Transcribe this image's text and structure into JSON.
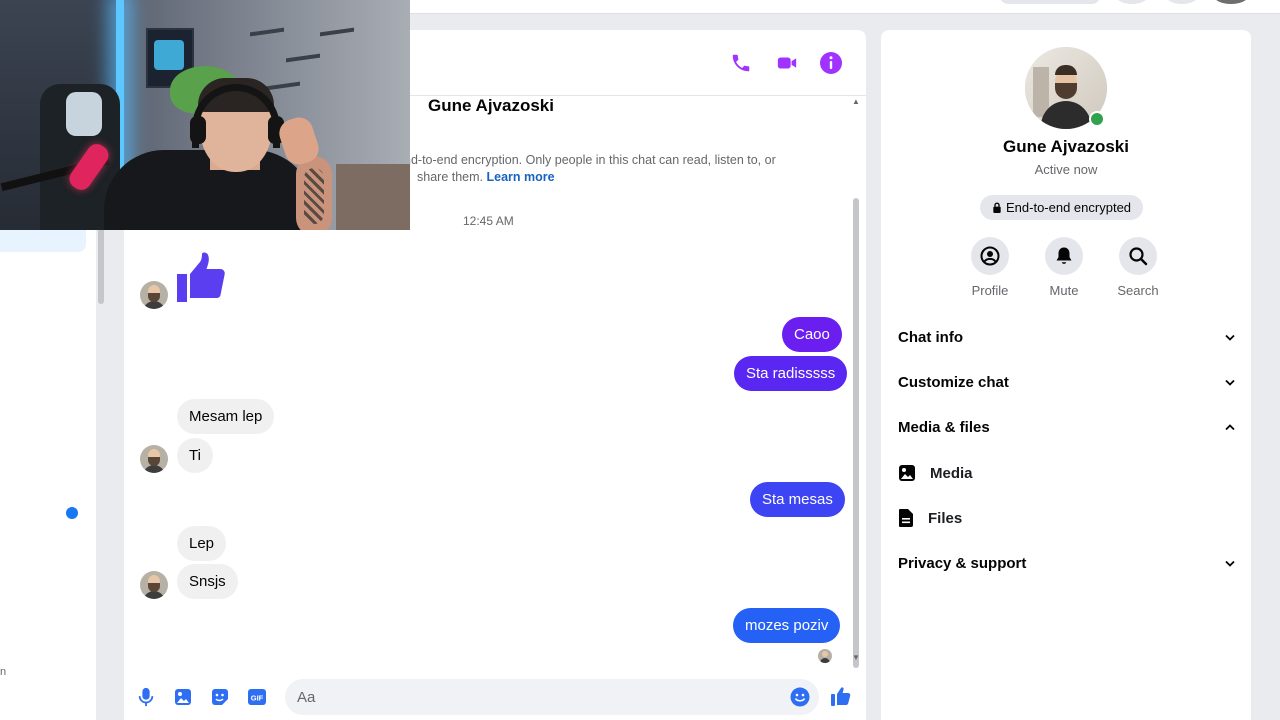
{
  "header": {
    "contact_name": "Gune Ajvazoski",
    "call_icon": "phone-icon",
    "video_icon": "video-camera-icon",
    "info_icon": "info-icon",
    "accent_color": "#a033ff"
  },
  "intro": {
    "name": "Gune Ajvazoski",
    "encryption_line1": "nd-to-end encryption. Only people in this chat can read, listen to, or",
    "encryption_line2": "share them.",
    "learn_more": "Learn more"
  },
  "timestamp": "12:45 AM",
  "messages": [
    {
      "dir": "in",
      "type": "like",
      "text": ""
    },
    {
      "dir": "out",
      "text": "Caoo",
      "color": "#6a1ef0"
    },
    {
      "dir": "out",
      "text": "Sta radisssss",
      "color": "#5a26f2"
    },
    {
      "dir": "in",
      "text": "Mesam lep"
    },
    {
      "dir": "in",
      "text": "Ti"
    },
    {
      "dir": "out",
      "text": "Sta mesas",
      "color": "#3c44f4"
    },
    {
      "dir": "in",
      "text": "Lep"
    },
    {
      "dir": "in",
      "text": "Snsjs"
    },
    {
      "dir": "out",
      "text": "mozes poziv",
      "color": "#2561f5"
    }
  ],
  "composer": {
    "placeholder": "Aa",
    "value": "",
    "icons": [
      "microphone-icon",
      "image-icon",
      "sticker-icon",
      "gif-icon",
      "emoji-icon",
      "thumbs-up-icon"
    ],
    "gif_label": "GIF",
    "accent_color": "#2e6ef2"
  },
  "profile": {
    "name": "Gune Ajvazoski",
    "status": "Active now",
    "encryption_badge": "End-to-end encrypted",
    "actions": [
      {
        "label": "Profile",
        "icon": "profile-icon"
      },
      {
        "label": "Mute",
        "icon": "bell-icon"
      },
      {
        "label": "Search",
        "icon": "search-icon"
      }
    ],
    "sections": {
      "chat_info": "Chat info",
      "customize_chat": "Customize chat",
      "media_files": "Media & files",
      "media": "Media",
      "files": "Files",
      "privacy_support": "Privacy & support"
    }
  },
  "left_rail": {
    "tiny_text": "n"
  }
}
